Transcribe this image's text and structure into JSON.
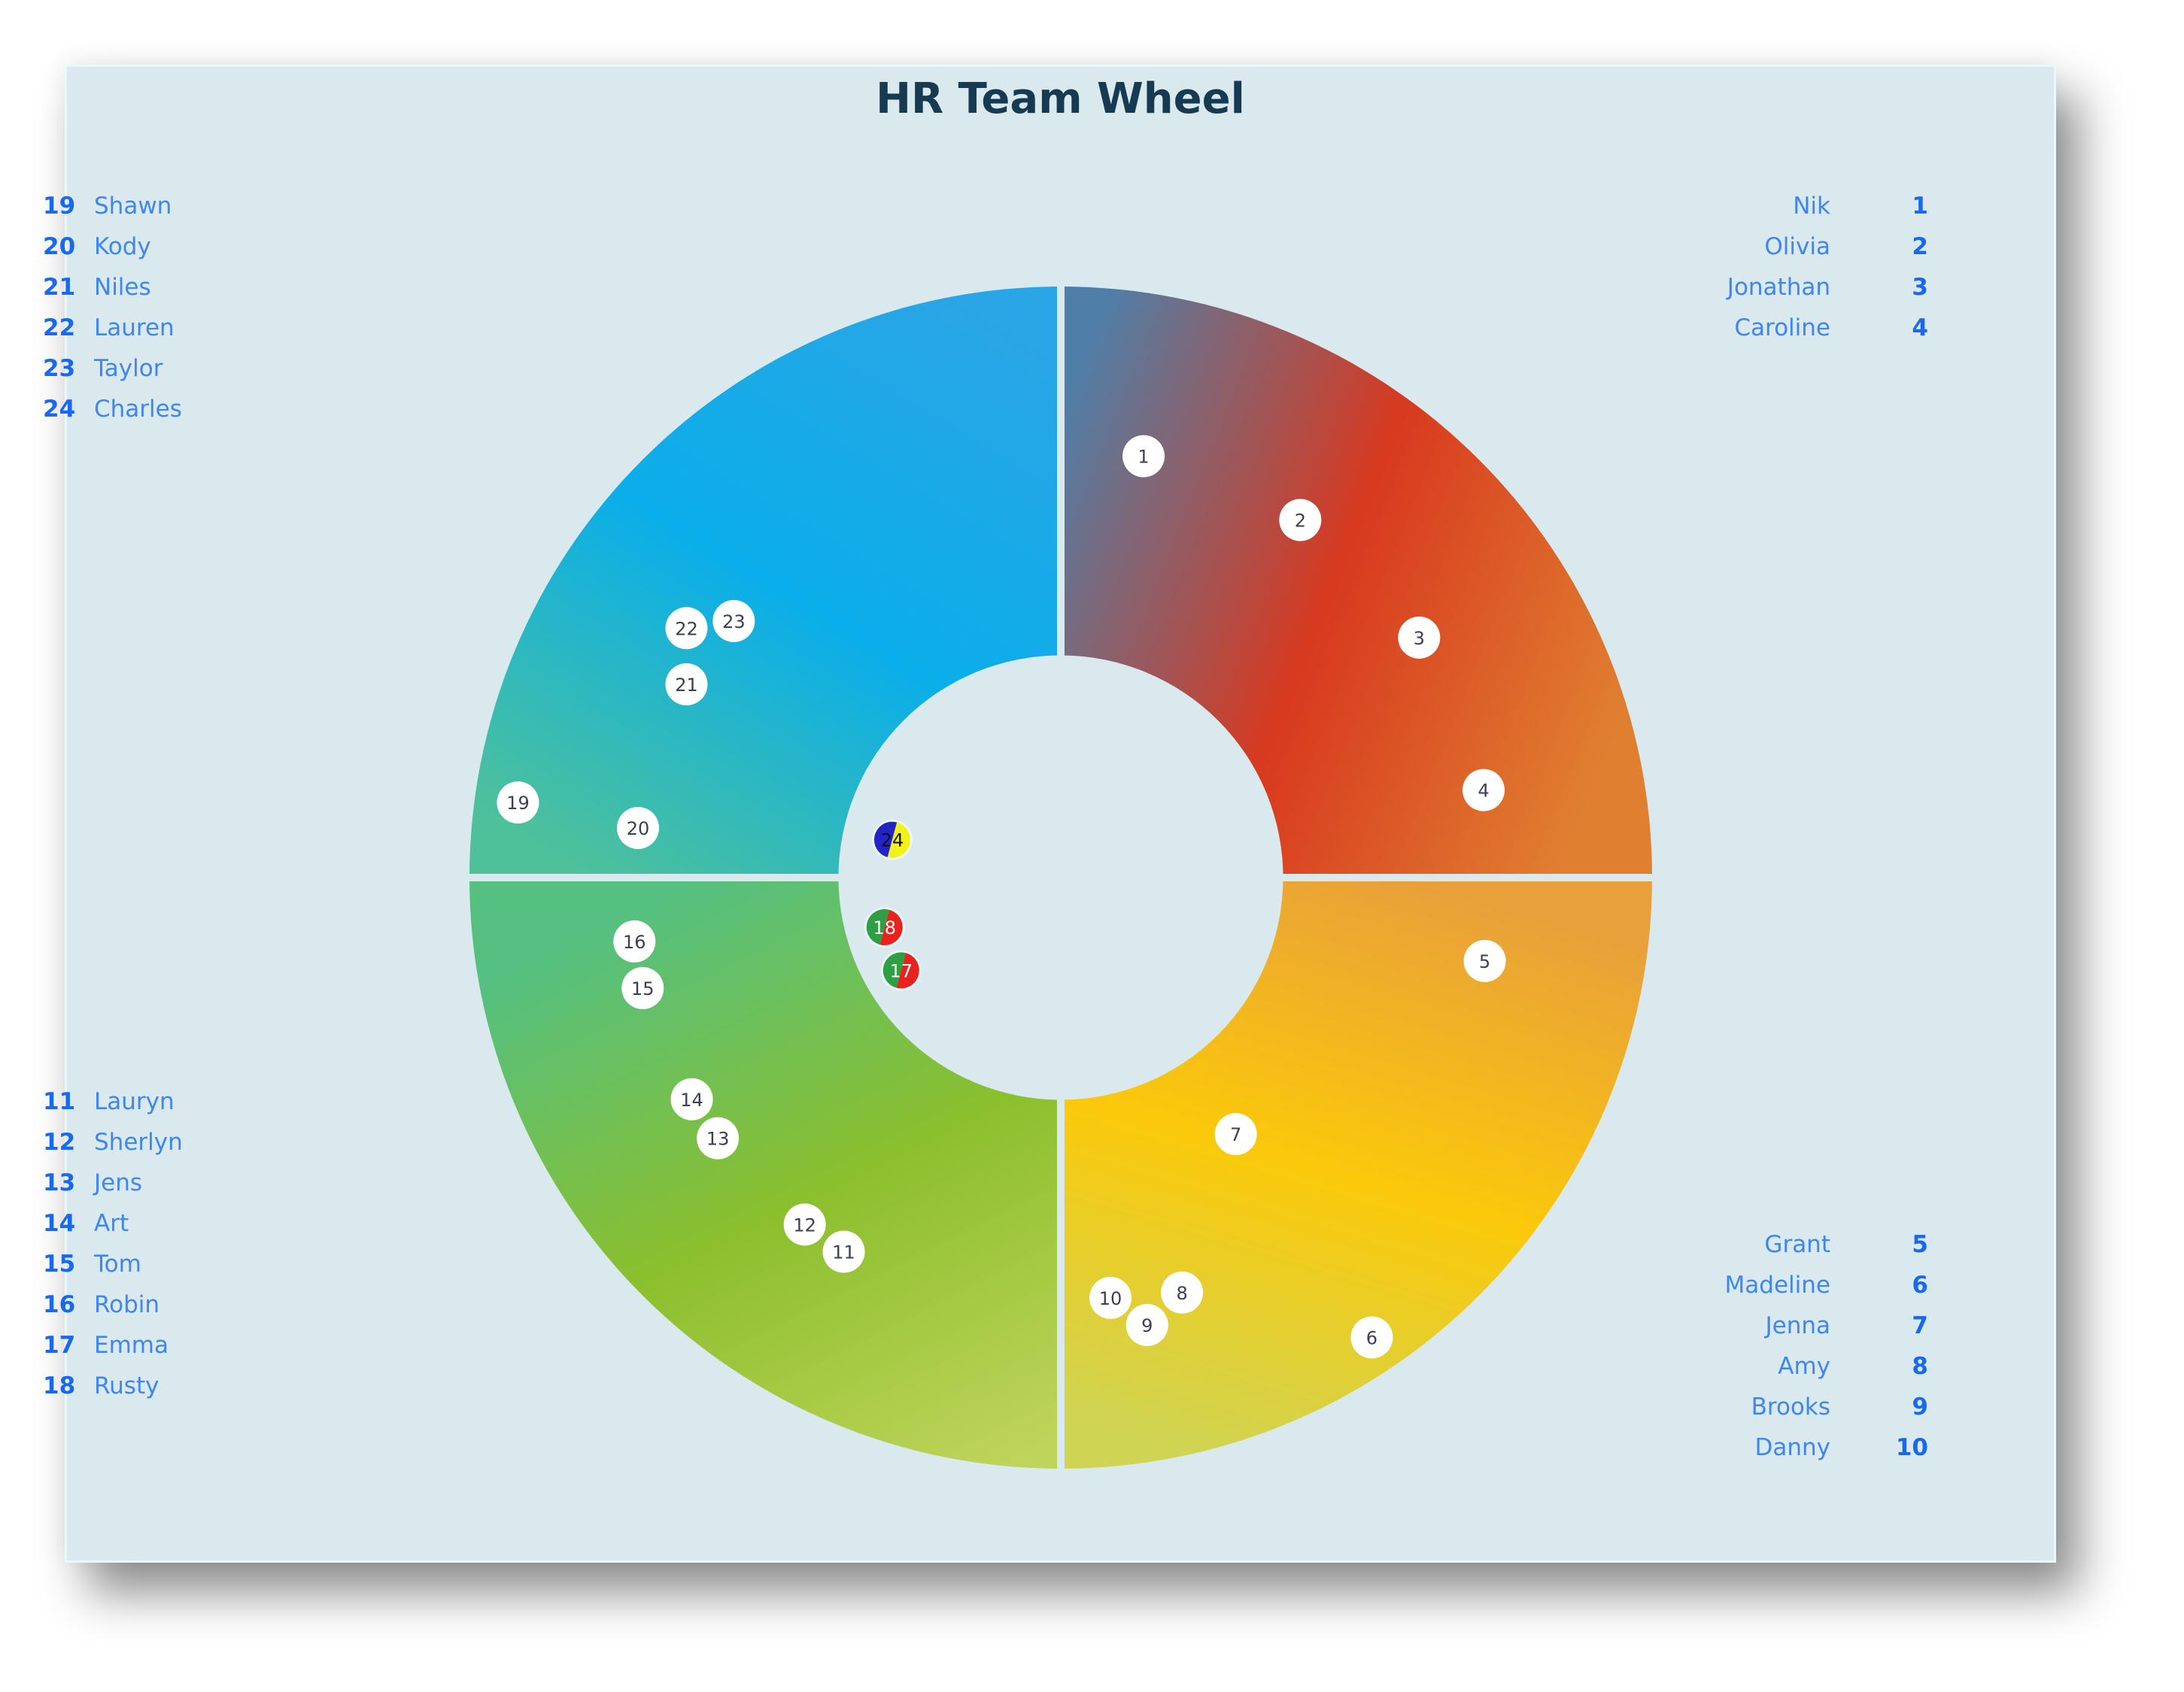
{
  "page": {
    "background": "#ffffff",
    "panel_background": "#d9e9ed"
  },
  "chart_data": {
    "type": "scatter",
    "subtype": "donut-wheel",
    "title": "HR Team Wheel",
    "inner_radius_ratio": 0.376,
    "quadrants": [
      {
        "id": "top-right",
        "colors": [
          "#4f7fa8",
          "#d8391f",
          "#e07f30"
        ]
      },
      {
        "id": "bottom-right",
        "colors": [
          "#e8a03a",
          "#fbc90a",
          "#cfd453"
        ]
      },
      {
        "id": "bottom-left",
        "colors": [
          "#55c080",
          "#8bbf2d",
          "#bfd45a"
        ]
      },
      {
        "id": "top-left",
        "colors": [
          "#2aa5e6",
          "#0aaeea",
          "#4ec19a"
        ]
      }
    ],
    "coordinate_note": "marker positions are normalized to the wheel: x,y in [-1,1] as fraction of outer radius from wheel center (y down)",
    "people": [
      {
        "id": 1,
        "name": "Nik",
        "x": 0.14,
        "y": -0.713,
        "style": "white"
      },
      {
        "id": 2,
        "name": "Olivia",
        "x": 0.405,
        "y": -0.605,
        "style": "white"
      },
      {
        "id": 3,
        "name": "Jonathan",
        "x": 0.606,
        "y": -0.406,
        "style": "white"
      },
      {
        "id": 4,
        "name": "Caroline",
        "x": 0.715,
        "y": -0.148,
        "style": "white"
      },
      {
        "id": 5,
        "name": "Grant",
        "x": 0.717,
        "y": 0.141,
        "style": "white"
      },
      {
        "id": 6,
        "name": "Madeline",
        "x": 0.526,
        "y": 0.778,
        "style": "white"
      },
      {
        "id": 7,
        "name": "Jenna",
        "x": 0.296,
        "y": 0.434,
        "style": "white"
      },
      {
        "id": 8,
        "name": "Amy",
        "x": 0.205,
        "y": 0.702,
        "style": "white"
      },
      {
        "id": 9,
        "name": "Brooks",
        "x": 0.146,
        "y": 0.757,
        "style": "white"
      },
      {
        "id": 10,
        "name": "Danny",
        "x": 0.084,
        "y": 0.711,
        "style": "white"
      },
      {
        "id": 11,
        "name": "Lauryn",
        "x": -0.367,
        "y": 0.633,
        "style": "white"
      },
      {
        "id": 12,
        "name": "Sherlyn",
        "x": -0.433,
        "y": 0.587,
        "style": "white"
      },
      {
        "id": 13,
        "name": "Jens",
        "x": -0.58,
        "y": 0.441,
        "style": "white"
      },
      {
        "id": 14,
        "name": "Art",
        "x": -0.624,
        "y": 0.375,
        "style": "white"
      },
      {
        "id": 15,
        "name": "Tom",
        "x": -0.707,
        "y": 0.187,
        "style": "white"
      },
      {
        "id": 16,
        "name": "Robin",
        "x": -0.721,
        "y": 0.108,
        "style": "white"
      },
      {
        "id": 17,
        "name": "Emma",
        "x": -0.27,
        "y": 0.157,
        "style": "green-red"
      },
      {
        "id": 18,
        "name": "Rusty",
        "x": -0.298,
        "y": 0.084,
        "style": "green-red"
      },
      {
        "id": 19,
        "name": "Shawn",
        "x": -0.918,
        "y": -0.127,
        "style": "white"
      },
      {
        "id": 20,
        "name": "Kody",
        "x": -0.715,
        "y": -0.084,
        "style": "white"
      },
      {
        "id": 21,
        "name": "Niles",
        "x": -0.633,
        "y": -0.327,
        "style": "white"
      },
      {
        "id": 22,
        "name": "Lauren",
        "x": -0.633,
        "y": -0.422,
        "style": "white"
      },
      {
        "id": 23,
        "name": "Taylor",
        "x": -0.553,
        "y": -0.434,
        "style": "white"
      },
      {
        "id": 24,
        "name": "Charles",
        "x": -0.285,
        "y": -0.064,
        "style": "blue-yellow"
      }
    ],
    "marker_styles": {
      "white": {
        "fill": "#ffffff",
        "text": "#3a3f55"
      },
      "green-red": {
        "left": "#2ea043",
        "right": "#e8231f",
        "text": "#ffffff"
      },
      "blue-yellow": {
        "left": "#2323c8",
        "right": "#f2f21a",
        "text": "#111111"
      }
    },
    "legends": {
      "top_left": [
        19,
        20,
        21,
        22,
        23,
        24
      ],
      "bottom_left": [
        11,
        12,
        13,
        14,
        15,
        16,
        17,
        18
      ],
      "top_right": [
        1,
        2,
        3,
        4
      ],
      "bottom_right": [
        5,
        6,
        7,
        8,
        9,
        10
      ]
    },
    "colors": {
      "legend_number": "#1868f0",
      "legend_name": "#3f86ef",
      "title": "#163a52",
      "divider": "#d9e9ed"
    }
  }
}
